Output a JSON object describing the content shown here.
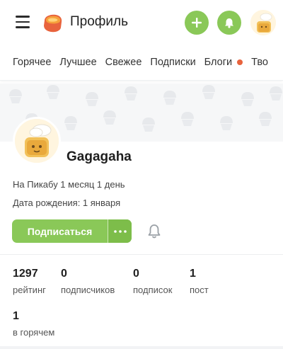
{
  "header": {
    "title": "Профиль",
    "icons": [
      "menu-icon",
      "logo-icon",
      "plus-icon",
      "bell-icon",
      "avatar"
    ],
    "accent": "#8ac858"
  },
  "nav": {
    "tabs": [
      {
        "label": "Горячее"
      },
      {
        "label": "Лучшее"
      },
      {
        "label": "Свежее"
      },
      {
        "label": "Подписки"
      },
      {
        "label": "Блоги",
        "dot": true
      },
      {
        "label": "Тво"
      }
    ],
    "dot_color": "#e8633d"
  },
  "profile": {
    "username": "Gagagaha",
    "since": "На Пикабу 1 месяц 1 день",
    "birthday": "Дата рождения: 1 января",
    "subscribe_label": "Подписаться",
    "more_icon": "more-dots-icon",
    "notify_icon": "bell-outline-icon"
  },
  "stats": [
    {
      "value": "1297",
      "label": "рейтинг"
    },
    {
      "value": "0",
      "label": "подписчиков"
    },
    {
      "value": "0",
      "label": "подписок"
    },
    {
      "value": "1",
      "label": "пост"
    },
    {
      "value": "1",
      "label": "в горячем"
    }
  ]
}
